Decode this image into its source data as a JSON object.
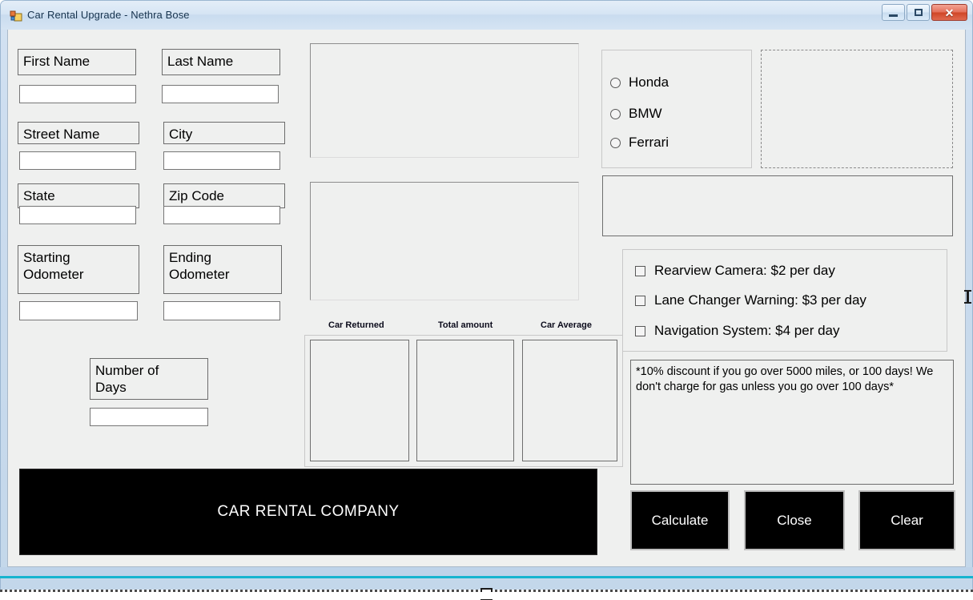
{
  "window": {
    "title": "Car Rental Upgrade - Nethra Bose",
    "icon": "form-designer-icon",
    "controls": {
      "minimize": "minimize-icon",
      "maximize": "maximize-icon",
      "close": "close-icon",
      "close_glyph": "✕"
    }
  },
  "form": {
    "fields": [
      {
        "label": "First Name",
        "value": "",
        "name": "first-name"
      },
      {
        "label": "Last Name",
        "value": "",
        "name": "last-name"
      },
      {
        "label": "Street Name",
        "value": "",
        "name": "street-name"
      },
      {
        "label": "City",
        "value": "",
        "name": "city"
      },
      {
        "label": "State",
        "value": "",
        "name": "state"
      },
      {
        "label": "Zip Code",
        "value": "",
        "name": "zip-code"
      },
      {
        "label": "Starting\nOdometer",
        "value": "",
        "name": "starting-odometer"
      },
      {
        "label": "Ending\nOdometer",
        "value": "",
        "name": "ending-odometer"
      },
      {
        "label": "Number of\nDays",
        "value": "",
        "name": "number-of-days"
      }
    ]
  },
  "car_models": {
    "options": [
      {
        "label": "Honda",
        "selected": false
      },
      {
        "label": "BMW",
        "selected": false
      },
      {
        "label": "Ferrari",
        "selected": false
      }
    ]
  },
  "upgrades": {
    "options": [
      {
        "label": "Rearview Camera: $2 per day",
        "checked": false
      },
      {
        "label": "Lane Changer Warning: $3 per day",
        "checked": false
      },
      {
        "label": "Navigation System: $4 per day",
        "checked": false
      }
    ]
  },
  "results": {
    "headers": [
      "Car Returned",
      "Total amount",
      "Car Average"
    ],
    "values": [
      "",
      "",
      ""
    ]
  },
  "notice": {
    "text": "*10% discount if you go over 5000 miles, or 100 days! We don't charge for gas unless you go over 100 days*"
  },
  "actions": {
    "calculate": "Calculate",
    "close": "Close",
    "clear": "Clear"
  },
  "banner": {
    "text": "CAR RENTAL COMPANY"
  },
  "colors": {
    "form_background": "#eff0ef",
    "banner_background": "#000000",
    "banner_text": "#ffffff",
    "titlebar_text": "#16334e",
    "frame": "#c3d7ea"
  }
}
